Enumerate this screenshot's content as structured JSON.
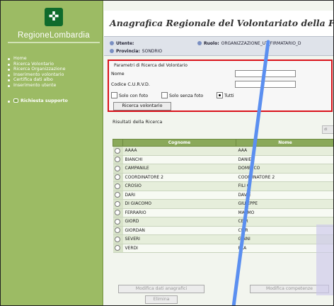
{
  "sidebar": {
    "brand": "RegioneLombardia",
    "logo_glyph": "✜",
    "items": [
      {
        "label": "Home"
      },
      {
        "label": "Ricerca Volontario"
      },
      {
        "label": "Ricerca Organizzazione"
      },
      {
        "label": "Inserimento volontario"
      },
      {
        "label": "Certifica dati albo"
      },
      {
        "label": "Inserimento utente"
      }
    ],
    "support_label": "Richiesta supporto"
  },
  "header": {
    "title": "Anagrafica Regionale del Volontariato della Pro"
  },
  "info": {
    "utente_label": "Utente:",
    "utente_value": "",
    "ruolo_label": "Ruolo:",
    "ruolo_value": "ORGANIZZAZIONE_UT_FIRMATARIO_D",
    "provincia_label": "Provincia:",
    "provincia_value": "SONDRIO"
  },
  "search": {
    "legend": "Parametri di Ricerca del Volontario",
    "nome_label": "Nome",
    "nome_value": "",
    "codice_label": "Codice C.U.R.V.D.",
    "codice_value": "",
    "opt_foto": "Solo con foto",
    "opt_senza": "Solo senza foto",
    "opt_tutti": "Tutti",
    "selected_option": "Tutti",
    "button_label": "Ricerca volontario"
  },
  "results": {
    "title": "Risultati della Ricerca",
    "columns": [
      "Cognome",
      "Nome"
    ],
    "rows": [
      {
        "cognome": "AAAA",
        "nome": "AAA"
      },
      {
        "cognome": "BIANCHI",
        "nome": "DANIE"
      },
      {
        "cognome": "CAMPANILE",
        "nome": "DOME  ICO"
      },
      {
        "cognome": "COORDINATORE 2",
        "nome": "COOR  INATORE 2"
      },
      {
        "cognome": "CROSIO",
        "nome": "FILI  O"
      },
      {
        "cognome": "DARI",
        "nome": "DAV  E"
      },
      {
        "cognome": "DI GIACOMO",
        "nome": "GIU  EPPE"
      },
      {
        "cognome": "FERRARIO",
        "nome": "MA  IMO"
      },
      {
        "cognome": "GIORD",
        "nome": "CE  R"
      },
      {
        "cognome": "GIORDAN",
        "nome": "CE  R"
      },
      {
        "cognome": "SEVERI",
        "nome": "G  NNI"
      },
      {
        "cognome": "VERDI",
        "nome": "  RLA"
      }
    ]
  },
  "actions": {
    "modifica_anagrafica": "Modifica dati anagrafici",
    "modifica_competenze": "Modifica competenze",
    "elimina": "Elimina"
  },
  "colors": {
    "sidebar": "#9cbb64",
    "header_green": "#8aa95a",
    "highlight_red": "#d9121b",
    "annotation_blue": "#5b8ff0"
  }
}
